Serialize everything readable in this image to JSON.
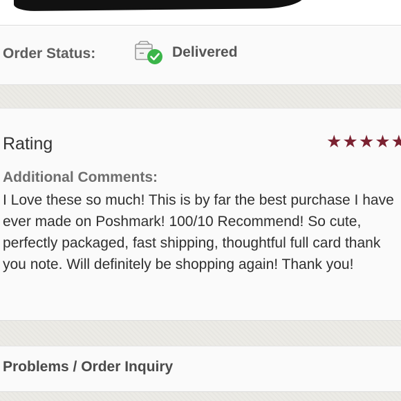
{
  "order_status": {
    "label": "Order Status:",
    "value": "Delivered",
    "icon": "delivered-box-check-icon",
    "check_color": "#3bb54a"
  },
  "rating": {
    "title": "Rating",
    "stars": "★★★★★",
    "star_color": "#7b2231",
    "comments_label": "Additional Comments:",
    "comment": "I Love these so much! This is by far the best purchase I have ever made on Poshmark! 100/10 Recommend! So cute, perfectly packaged, fast shipping, thoughtful full card thank you note. Will definitely be shopping again! Thank you!"
  },
  "problems": {
    "label": "Problems / Order Inquiry"
  }
}
